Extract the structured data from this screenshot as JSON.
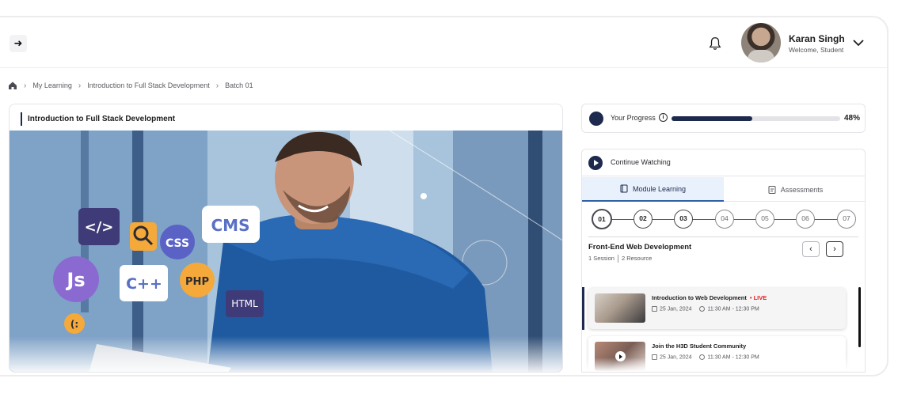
{
  "topbar": {
    "back_icon": "arrow-right-icon",
    "notification_icon": "bell-icon",
    "user": {
      "name": "Karan Singh",
      "subtitle": "Welcome, Student"
    },
    "dropdown_icon": "chevron-down-icon"
  },
  "breadcrumb": {
    "home_icon": "home-icon",
    "items": [
      "My Learning",
      "Introduction to Full Stack Development",
      "Batch 01"
    ],
    "separator": "›"
  },
  "video": {
    "title": "Introduction to Full Stack Development",
    "badges": [
      "</>",
      "CSS",
      "CMS",
      "Js",
      "C++",
      "PHP",
      "HTML",
      "(:"
    ]
  },
  "progress": {
    "label": "Your Progress",
    "info_icon": "info-icon",
    "value": 0.48,
    "percent_label": "48%"
  },
  "continue_watching": {
    "label": "Continue Watching",
    "icon": "play-circle-icon"
  },
  "tabs": [
    {
      "label": "Module Learning",
      "icon": "book-icon",
      "active": true
    },
    {
      "label": "Assessments",
      "icon": "clipboard-icon",
      "active": false
    }
  ],
  "modules": {
    "steps": [
      "01",
      "02",
      "03",
      "04",
      "05",
      "06",
      "07"
    ],
    "current_step": "01",
    "title": "Front-End Web Development",
    "sessions_count": "1 Session",
    "resources_count": "2 Resource",
    "prev_icon": "chevron-left-icon",
    "next_icon": "chevron-right-icon"
  },
  "sessions": [
    {
      "title": "Introduction to Web Development",
      "badge": "• LIVE",
      "date": "25 Jan, 2024",
      "time": "11:30 AM - 12:30 PM"
    },
    {
      "title": "Join the H3D Student Community",
      "badge": "",
      "date": "25 Jan, 2024",
      "time": "11:30 AM - 12:30 PM"
    }
  ],
  "colors": {
    "primary": "#1d2a4d",
    "live": "#e21d1d",
    "tab_active_bg": "#e8f1fc"
  }
}
